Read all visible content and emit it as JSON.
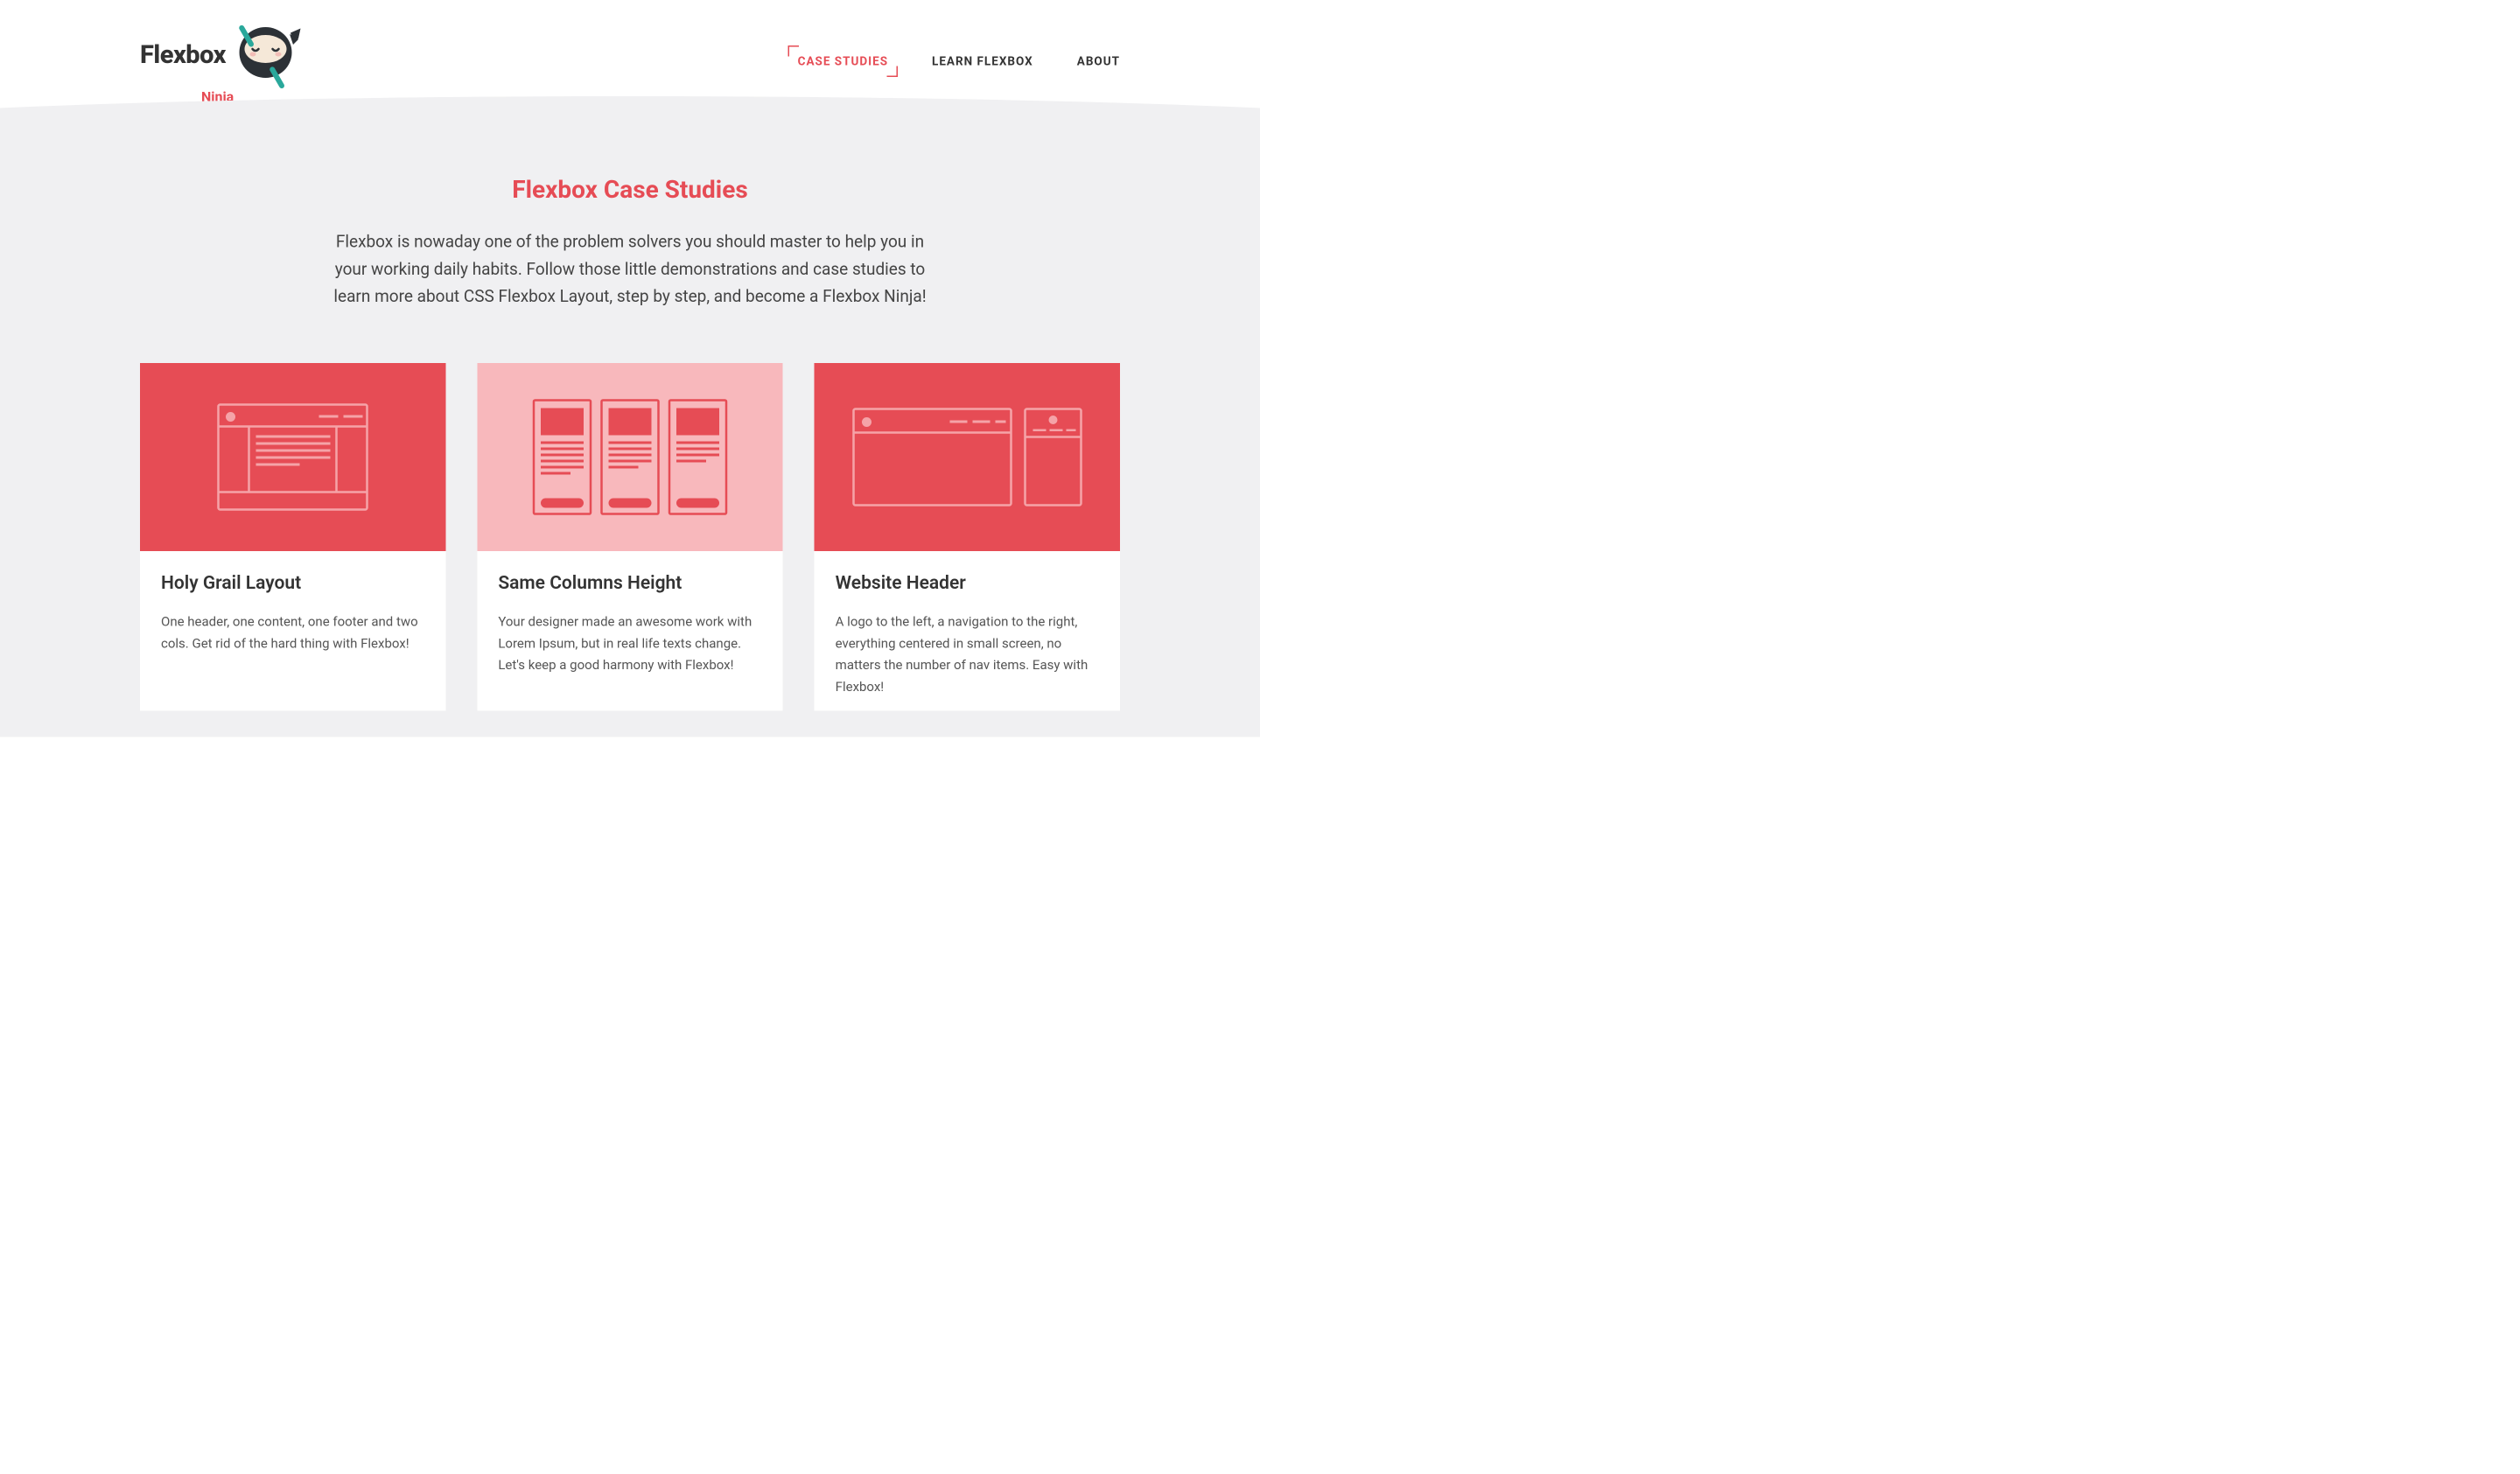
{
  "logo": {
    "main": "Flexbox",
    "sub": "Ninja"
  },
  "nav": {
    "items": [
      {
        "label": "CASE STUDIES",
        "active": true
      },
      {
        "label": "LEARN FLEXBOX",
        "active": false
      },
      {
        "label": "ABOUT",
        "active": false
      }
    ]
  },
  "page": {
    "title": "Flexbox Case Studies",
    "intro": "Flexbox is nowaday one of the problem solvers you should master to help you in your working daily habits. Follow those little demonstrations and case studies to learn more about CSS Flexbox Layout, step by step, and become a Flexbox Ninja!"
  },
  "cards": [
    {
      "title": "Holy Grail Layout",
      "desc": "One header, one content, one footer and two cols. Get rid of the hard thing with Flexbox!",
      "bg": "red",
      "illustration": "holy-grail"
    },
    {
      "title": "Same Columns Height",
      "desc": "Your designer made an awesome work with Lorem Ipsum, but in real life texts change. Let's keep a good harmony with Flexbox!",
      "bg": "pink",
      "illustration": "columns"
    },
    {
      "title": "Website Header",
      "desc": "A logo to the left, a navigation to the right, everything centered in small screen, no matters the number of nav items. Easy with Flexbox!",
      "bg": "red",
      "illustration": "header"
    }
  ]
}
